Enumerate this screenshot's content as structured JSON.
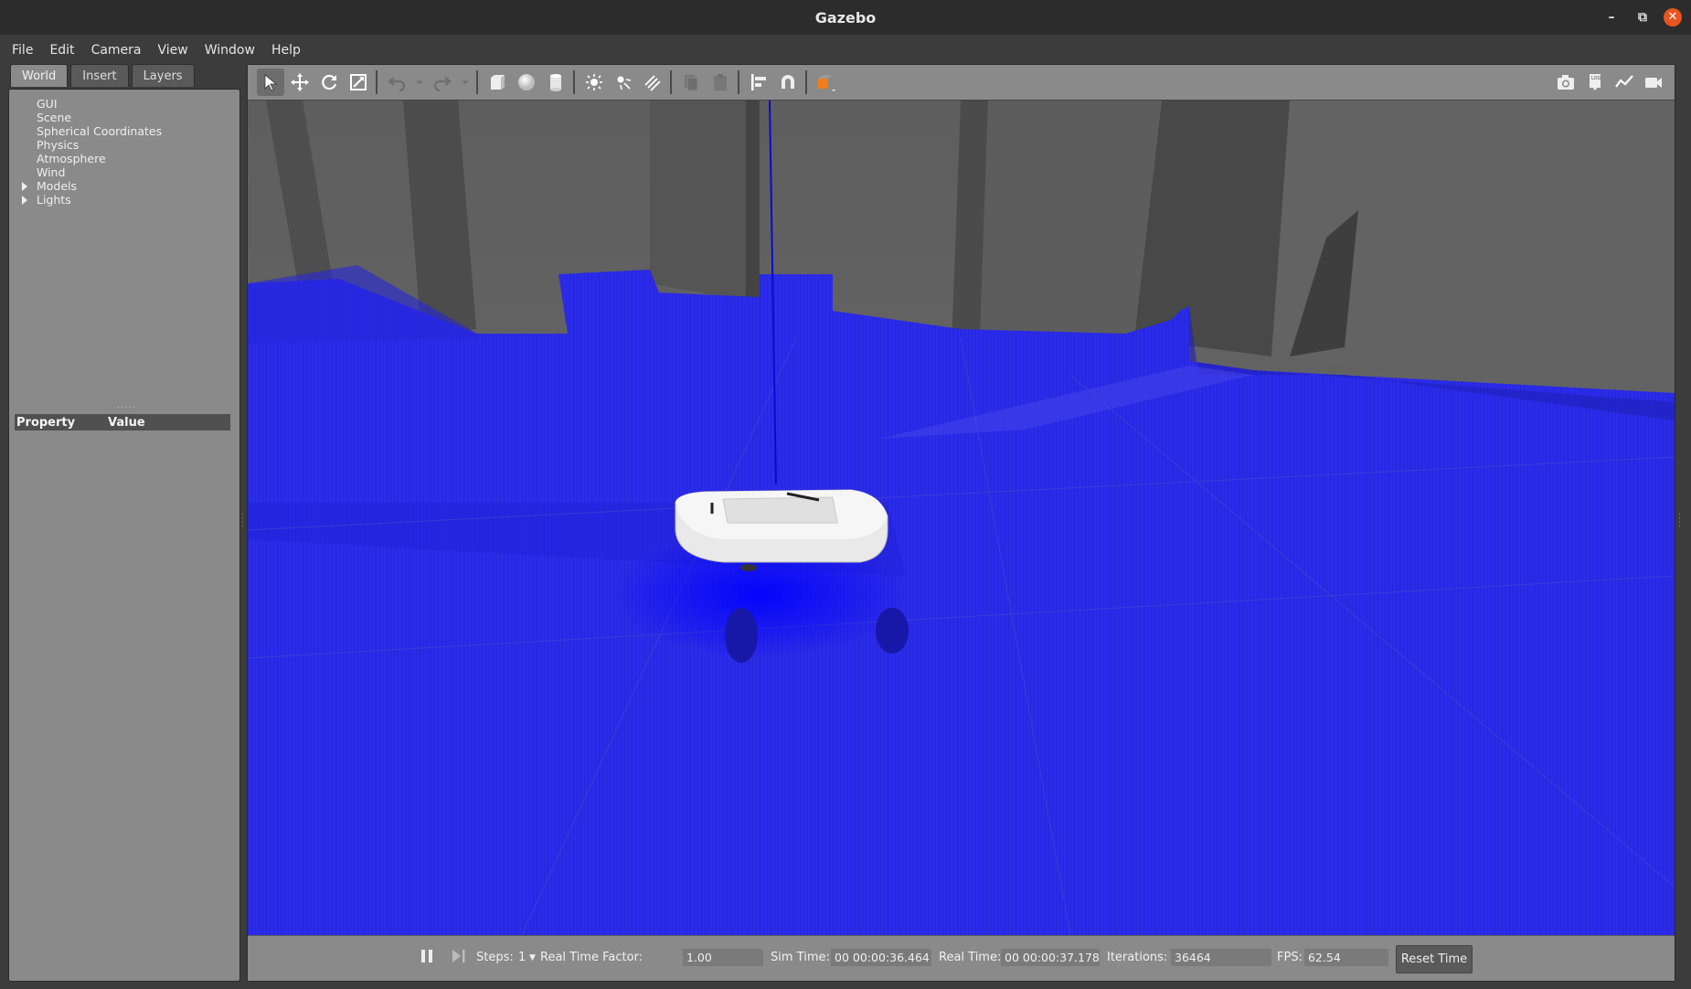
{
  "window": {
    "title": "Gazebo"
  },
  "menu": [
    "File",
    "Edit",
    "Camera",
    "View",
    "Window",
    "Help"
  ],
  "left_panel": {
    "tabs": [
      "World",
      "Insert",
      "Layers"
    ],
    "active_tab": "World",
    "tree": [
      {
        "label": "GUI",
        "expandable": false
      },
      {
        "label": "Scene",
        "expandable": false
      },
      {
        "label": "Spherical Coordinates",
        "expandable": false
      },
      {
        "label": "Physics",
        "expandable": false
      },
      {
        "label": "Atmosphere",
        "expandable": false
      },
      {
        "label": "Wind",
        "expandable": false
      },
      {
        "label": "Models",
        "expandable": true
      },
      {
        "label": "Lights",
        "expandable": true
      }
    ],
    "property_header": {
      "property": "Property",
      "value": "Value"
    }
  },
  "toolbar": {
    "tools": [
      "select-arrow-icon",
      "translate-icon",
      "rotate-icon",
      "scale-icon",
      "undo-icon",
      "redo-icon",
      "box-icon",
      "sphere-icon",
      "cylinder-icon",
      "point-light-icon",
      "spot-light-icon",
      "directional-light-icon",
      "copy-icon",
      "paste-icon",
      "align-icon",
      "snap-icon",
      "view-angle-icon"
    ],
    "right_tools": [
      "screenshot-icon",
      "log-icon",
      "plot-icon",
      "video-record-icon"
    ]
  },
  "bottom_bar": {
    "steps_label": "Steps:",
    "steps_value": "1",
    "rtf_label": "Real Time Factor:",
    "rtf_value": "1.00",
    "sim_time_label": "Sim Time:",
    "sim_time_value": "00 00:00:36.464",
    "real_time_label": "Real Time:",
    "real_time_value": "00 00:00:37.178",
    "iterations_label": "Iterations:",
    "iterations_value": "36464",
    "fps_label": "FPS:",
    "fps_value": "62.54",
    "reset_label": "Reset Time"
  },
  "colors": {
    "laser_blue": "#2a2ae6",
    "panel_gray": "#8a8a8a",
    "close_orange": "#e95420"
  }
}
